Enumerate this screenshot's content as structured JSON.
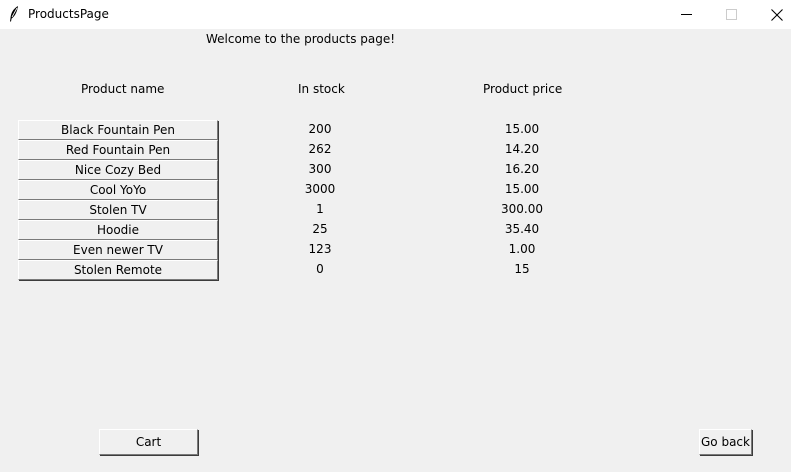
{
  "window": {
    "title": "ProductsPage",
    "app_icon": "feather-icon",
    "controls": [
      "minimize-icon",
      "maximize-icon",
      "close-icon"
    ]
  },
  "page": {
    "welcome": "Welcome to the products page!"
  },
  "table": {
    "headers": {
      "name": "Product name",
      "stock": "In stock",
      "price": "Product price"
    },
    "rows": [
      {
        "name": "Black Fountain Pen",
        "stock": "200",
        "price": "15.00"
      },
      {
        "name": "Red Fountain Pen",
        "stock": "262",
        "price": "14.20"
      },
      {
        "name": "Nice Cozy Bed",
        "stock": "300",
        "price": "16.20"
      },
      {
        "name": "Cool YoYo",
        "stock": "3000",
        "price": "15.00"
      },
      {
        "name": "Stolen TV",
        "stock": "1",
        "price": "300.00"
      },
      {
        "name": "Hoodie",
        "stock": "25",
        "price": "35.40"
      },
      {
        "name": "Even newer TV",
        "stock": "123",
        "price": "1.00"
      },
      {
        "name": "Stolen Remote",
        "stock": "0",
        "price": "15"
      }
    ]
  },
  "buttons": {
    "cart": "Cart",
    "go_back": "Go back"
  }
}
